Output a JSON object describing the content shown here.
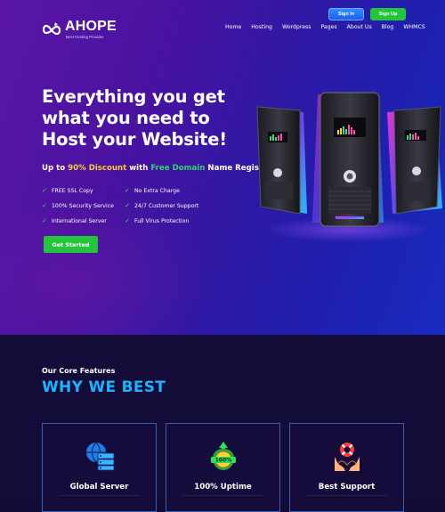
{
  "brand": {
    "name": "AHOPE",
    "tagline": "Best Hosting Provider"
  },
  "auth": {
    "signin": "Sign In",
    "signup": "Sign Up"
  },
  "nav": [
    "Home",
    "Hosting",
    "Wordpress",
    "Pages",
    "About Us",
    "Blog",
    "WHMCS"
  ],
  "hero": {
    "headline": "Everything you get what you need to Host your Website!",
    "promo": {
      "pre": "Up to ",
      "discount": "90% Discount",
      "mid": " with ",
      "domain": "Free Domain",
      "post": " Name Registration!"
    },
    "features": [
      "FREE SSL Copy",
      "No Extra Charge",
      "100% Security Service",
      "24/7 Customer Support",
      "International Server",
      "Full Virus Protection"
    ],
    "cta": "Get Started"
  },
  "section": {
    "eyebrow": "Our Core Features",
    "title": "WHY WE BEST",
    "cards": [
      {
        "title": "Global Server",
        "icon": "global-server-icon"
      },
      {
        "title": "100% Uptime",
        "icon": "uptime-badge-icon",
        "badge": "100%"
      },
      {
        "title": "Best Support",
        "icon": "support-lifebuoy-icon"
      }
    ]
  },
  "colors": {
    "accent_green": "#23c53a",
    "accent_blue": "#19b6ff",
    "accent_yellow": "#ffc83a",
    "hero_purple": "#5a16a6",
    "hero_blue": "#1a2bbf",
    "dark_bg": "#130b38"
  }
}
